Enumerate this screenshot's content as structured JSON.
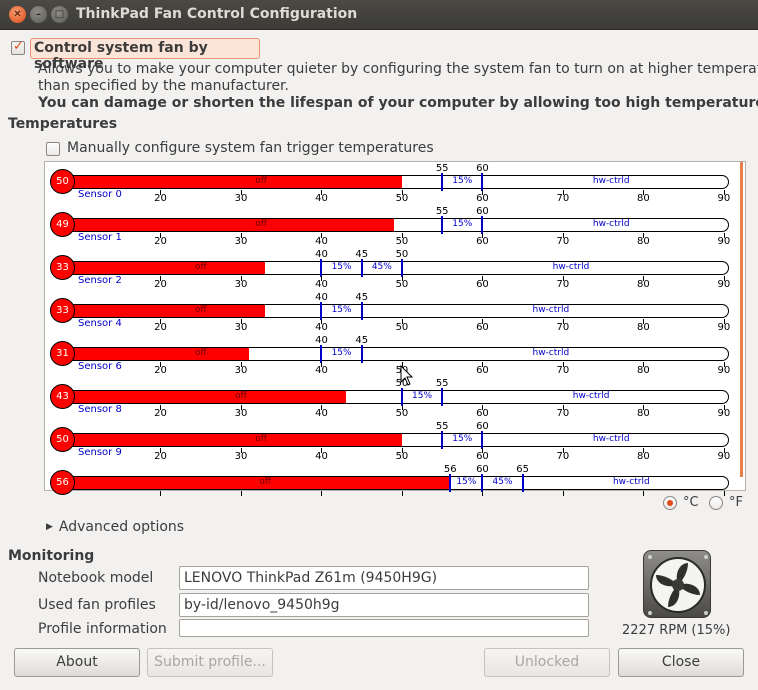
{
  "window": {
    "title": "ThinkPad Fan Control Configuration"
  },
  "control": {
    "label": "Control system fan by software",
    "checked": true,
    "description1": "Allows you to make your computer quieter by configuring the system fan to turn on at higher temperatures",
    "description2": "than specified by the manufacturer.",
    "warning": "You can damage or shorten the lifespan of your computer by allowing too high temperatures."
  },
  "temperatures": {
    "heading": "Temperatures",
    "manual_label": "Manually configure system fan trigger temperatures",
    "manual_checked": false,
    "scale_min": 10,
    "scale_max": 92,
    "ticks": [
      20,
      30,
      40,
      50,
      60,
      70,
      80,
      90
    ],
    "sensors": [
      {
        "name": "Sensor 0",
        "temp": "50",
        "value": 50,
        "thresholds": [
          55,
          60
        ],
        "labels": [
          "off",
          "15%",
          "hw-ctrld"
        ]
      },
      {
        "name": "Sensor 1",
        "temp": "49",
        "value": 49,
        "thresholds": [
          55,
          60
        ],
        "labels": [
          "off",
          "15%",
          "hw-ctrld"
        ]
      },
      {
        "name": "Sensor 2",
        "temp": "33",
        "value": 33,
        "thresholds": [
          40,
          45,
          50
        ],
        "labels": [
          "off",
          "15%",
          "45%",
          "hw-ctrld"
        ]
      },
      {
        "name": "Sensor 4",
        "temp": "33",
        "value": 33,
        "thresholds": [
          40,
          45
        ],
        "labels": [
          "off",
          "15%",
          "hw-ctrld"
        ]
      },
      {
        "name": "Sensor 6",
        "temp": "31",
        "value": 31,
        "thresholds": [
          40,
          45
        ],
        "labels": [
          "off",
          "15%",
          "hw-ctrld"
        ]
      },
      {
        "name": "Sensor 8",
        "temp": "43",
        "value": 43,
        "thresholds": [
          50,
          55
        ],
        "labels": [
          "off",
          "15%",
          "hw-ctrld"
        ]
      },
      {
        "name": "Sensor 9",
        "temp": "50",
        "value": 50,
        "thresholds": [
          55,
          60
        ],
        "labels": [
          "off",
          "15%",
          "hw-ctrld"
        ]
      },
      {
        "name": "",
        "temp": "56",
        "value": 56,
        "thresholds": [
          56,
          60,
          65
        ],
        "labels": [
          "off",
          "15%",
          "45%",
          "hw-ctrld"
        ],
        "partial": true
      }
    ],
    "unit_celsius": "°C",
    "unit_fahrenheit": "°F",
    "unit_selected": "C"
  },
  "advanced": {
    "label": "Advanced options"
  },
  "monitoring": {
    "heading": "Monitoring",
    "model_label": "Notebook model",
    "model_value": "LENOVO ThinkPad Z61m (9450H9G)",
    "profiles_label": "Used fan profiles",
    "profiles_value": "by-id/lenovo_9450h9g",
    "info_label": "Profile information",
    "info_value": "",
    "rpm": "2227 RPM (15%)"
  },
  "buttons": {
    "about": "About",
    "submit": "Submit profile...",
    "unlocked": "Unlocked",
    "close": "Close"
  },
  "colors": {
    "accent": "#df4a16",
    "hot": "#ff0000",
    "fan_on": "#ff7f00",
    "marker": "#0000cc"
  }
}
